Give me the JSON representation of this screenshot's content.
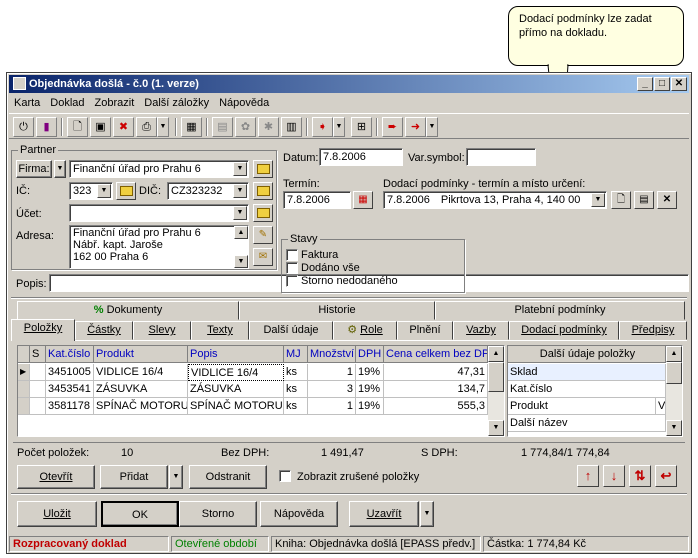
{
  "callout": {
    "text": "Dodací podmínky lze zadat přímo na dokladu."
  },
  "window": {
    "title": "Objednávka došlá - č.0 (1. verze)"
  },
  "menu": [
    "Karta",
    "Doklad",
    "Zobrazit",
    "Další záložky",
    "Nápověda"
  ],
  "partner": {
    "group_label": "Partner",
    "firma_label": "Firma:",
    "firma_value": "Finanční úřad pro Prahu 6",
    "ic_label": "IČ:",
    "ic_value": "323",
    "dic_label": "DIČ:",
    "dic_value": "CZ323232",
    "ucet_label": "Účet:",
    "ucet_value": "",
    "adresa_label": "Adresa:",
    "adresa_lines": [
      "Finanční úřad pro Prahu 6",
      "Nábř. kapt. Jaroše",
      "162 00 Praha 6"
    ]
  },
  "popis": {
    "label": "Popis:",
    "value": ""
  },
  "datum": {
    "label": "Datum:",
    "value": "7.8.2006"
  },
  "varsymbol": {
    "label": "Var.symbol:",
    "value": ""
  },
  "termin": {
    "label": "Termín:",
    "value": "7.8.2006"
  },
  "dodaci": {
    "label": "Dodací podmínky - termín a místo určení:",
    "date": "7.8.2006",
    "place": "Pikrtova 13, Praha 4, 140 00"
  },
  "stavy": {
    "label": "Stavy",
    "items": [
      "Faktura",
      "Dodáno vše",
      "Storno nedodaného"
    ]
  },
  "tabs_top": [
    "Dokumenty",
    "Historie",
    "Platební podmínky"
  ],
  "tabs_bottom": [
    "Položky",
    "Částky",
    "Slevy",
    "Texty",
    "Další údaje",
    "Role",
    "Plnění",
    "Vazby",
    "Dodací podmínky",
    "Předpisy"
  ],
  "grid": {
    "headers": [
      "S",
      "Kat.číslo",
      "Produkt",
      "Popis",
      "MJ",
      "Množství",
      "DPH",
      "Cena celkem bez DPH"
    ],
    "rows": [
      [
        "",
        "3451005",
        "VIDLICE 16/4",
        "VIDLICE 16/4",
        "ks",
        "1",
        "19%",
        "47,31"
      ],
      [
        "",
        "3453541",
        "ZÁSUVKA",
        "ZÁSUVKA",
        "ks",
        "3",
        "19%",
        "134,7"
      ],
      [
        "",
        "3581178",
        "SPÍNAČ MOTORU",
        "SPÍNAČ MOTORU",
        "ks",
        "1",
        "19%",
        "555,3"
      ]
    ]
  },
  "side_panel": {
    "title": "Další údaje položky",
    "items": [
      "Sklad",
      "Kat.číslo",
      "Produkt",
      "Další název"
    ],
    "value": "V"
  },
  "summary": {
    "count_label": "Počet položek:",
    "count_value": "10",
    "bezdph_label": "Bez DPH:",
    "bezdph_value": "1 491,47",
    "sdph_label": "S DPH:",
    "sdph_value": "1 774,84/1 774,84"
  },
  "item_buttons": {
    "otevrit": "Otevřít",
    "pridat": "Přidat",
    "odstranit": "Odstranit",
    "show_cancelled": "Zobrazit zrušené položky"
  },
  "bottom_buttons": {
    "ulozit": "Uložit",
    "ok": "OK",
    "storno": "Storno",
    "napoveda": "Nápověda",
    "uzavrit": "Uzavřít"
  },
  "statusbar": {
    "state": "Rozpracovaný doklad",
    "period": "Otevřené období",
    "book": "Kniha: Objednávka došlá [EPASS předv.]",
    "amount": "Částka: 1 774,84 Kč"
  }
}
